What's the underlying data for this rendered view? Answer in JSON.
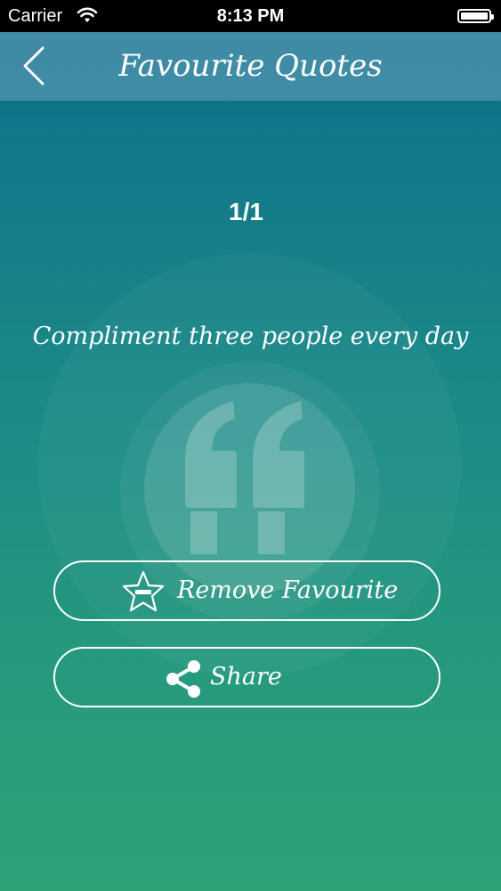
{
  "status_bar": {
    "carrier": "Carrier",
    "time": "8:13 PM",
    "wifi_icon": "wifi-icon",
    "battery_icon": "battery-icon"
  },
  "nav": {
    "title": "Favourite Quotes",
    "back_icon": "chevron-left-icon"
  },
  "quote": {
    "counter": "1/1",
    "text": "Compliment three people every day",
    "decoration_icon": "quote-mark-icon"
  },
  "actions": {
    "remove_label": "Remove Favourite",
    "remove_icon": "star-minus-icon",
    "share_label": "Share",
    "share_icon": "share-icon"
  },
  "colors": {
    "gradient_top": "#0a6583",
    "gradient_bottom": "#2ea377",
    "nav_bar": "#5096af",
    "text": "#ffffff"
  }
}
